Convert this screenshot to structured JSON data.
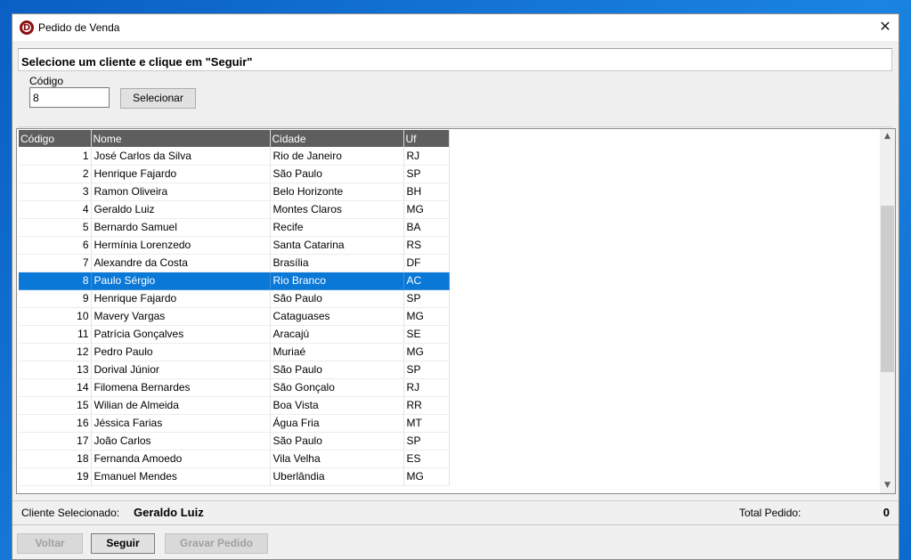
{
  "window": {
    "title": "Pedido de Venda",
    "app_icon_letter": "D",
    "close_glyph": "✕"
  },
  "banner": {
    "text": "Selecione um cliente e clique em \"Seguir\""
  },
  "filter": {
    "codigo_label": "Código",
    "codigo_value": "8",
    "selecionar_label": "Selecionar"
  },
  "grid": {
    "headers": [
      "Código",
      "Nome",
      "Cidade",
      "Uf"
    ],
    "selected_row": 7,
    "rows": [
      [
        "1",
        "José Carlos da Silva",
        "Rio de Janeiro",
        "RJ"
      ],
      [
        "2",
        "Henrique Fajardo",
        "São Paulo",
        "SP"
      ],
      [
        "3",
        "Ramon Oliveira",
        "Belo Horizonte",
        "BH"
      ],
      [
        "4",
        "Geraldo Luiz",
        "Montes Claros",
        "MG"
      ],
      [
        "5",
        "Bernardo Samuel",
        "Recife",
        "BA"
      ],
      [
        "6",
        "Hermínia Lorenzedo",
        "Santa Catarina",
        "RS"
      ],
      [
        "7",
        "Alexandre da Costa",
        "Brasília",
        "DF"
      ],
      [
        "8",
        "Paulo Sérgio",
        "Rio Branco",
        "AC"
      ],
      [
        "9",
        "Henrique Fajardo",
        "São Paulo",
        "SP"
      ],
      [
        "10",
        "Mavery Vargas",
        "Cataguases",
        "MG"
      ],
      [
        "11",
        "Patrícia Gonçalves",
        "Aracajú",
        "SE"
      ],
      [
        "12",
        "Pedro Paulo",
        "Muriaé",
        "MG"
      ],
      [
        "13",
        "Dorival Júnior",
        "São Paulo",
        "SP"
      ],
      [
        "14",
        "Filomena Bernardes",
        "São Gonçalo",
        "RJ"
      ],
      [
        "15",
        "Wilian de Almeida",
        "Boa Vista",
        "RR"
      ],
      [
        "16",
        "Jéssica Farias",
        "Água Fria",
        "MT"
      ],
      [
        "17",
        "João Carlos",
        "São Paulo",
        "SP"
      ],
      [
        "18",
        "Fernanda Amoedo",
        "Vila Velha",
        "ES"
      ],
      [
        "19",
        "Emanuel Mendes",
        "Uberlândia",
        "MG"
      ]
    ]
  },
  "status": {
    "cliente_label": "Cliente Selecionado:",
    "cliente_value": "Geraldo Luiz",
    "total_label": "Total Pedido:",
    "total_value": "0"
  },
  "footer": {
    "voltar_label": "Voltar",
    "seguir_label": "Seguir",
    "gravar_label": "Gravar Pedido"
  },
  "colors": {
    "header_bg": "#5e5e5e",
    "selection": "#0a78d7",
    "app_icon": "#8b1111"
  }
}
